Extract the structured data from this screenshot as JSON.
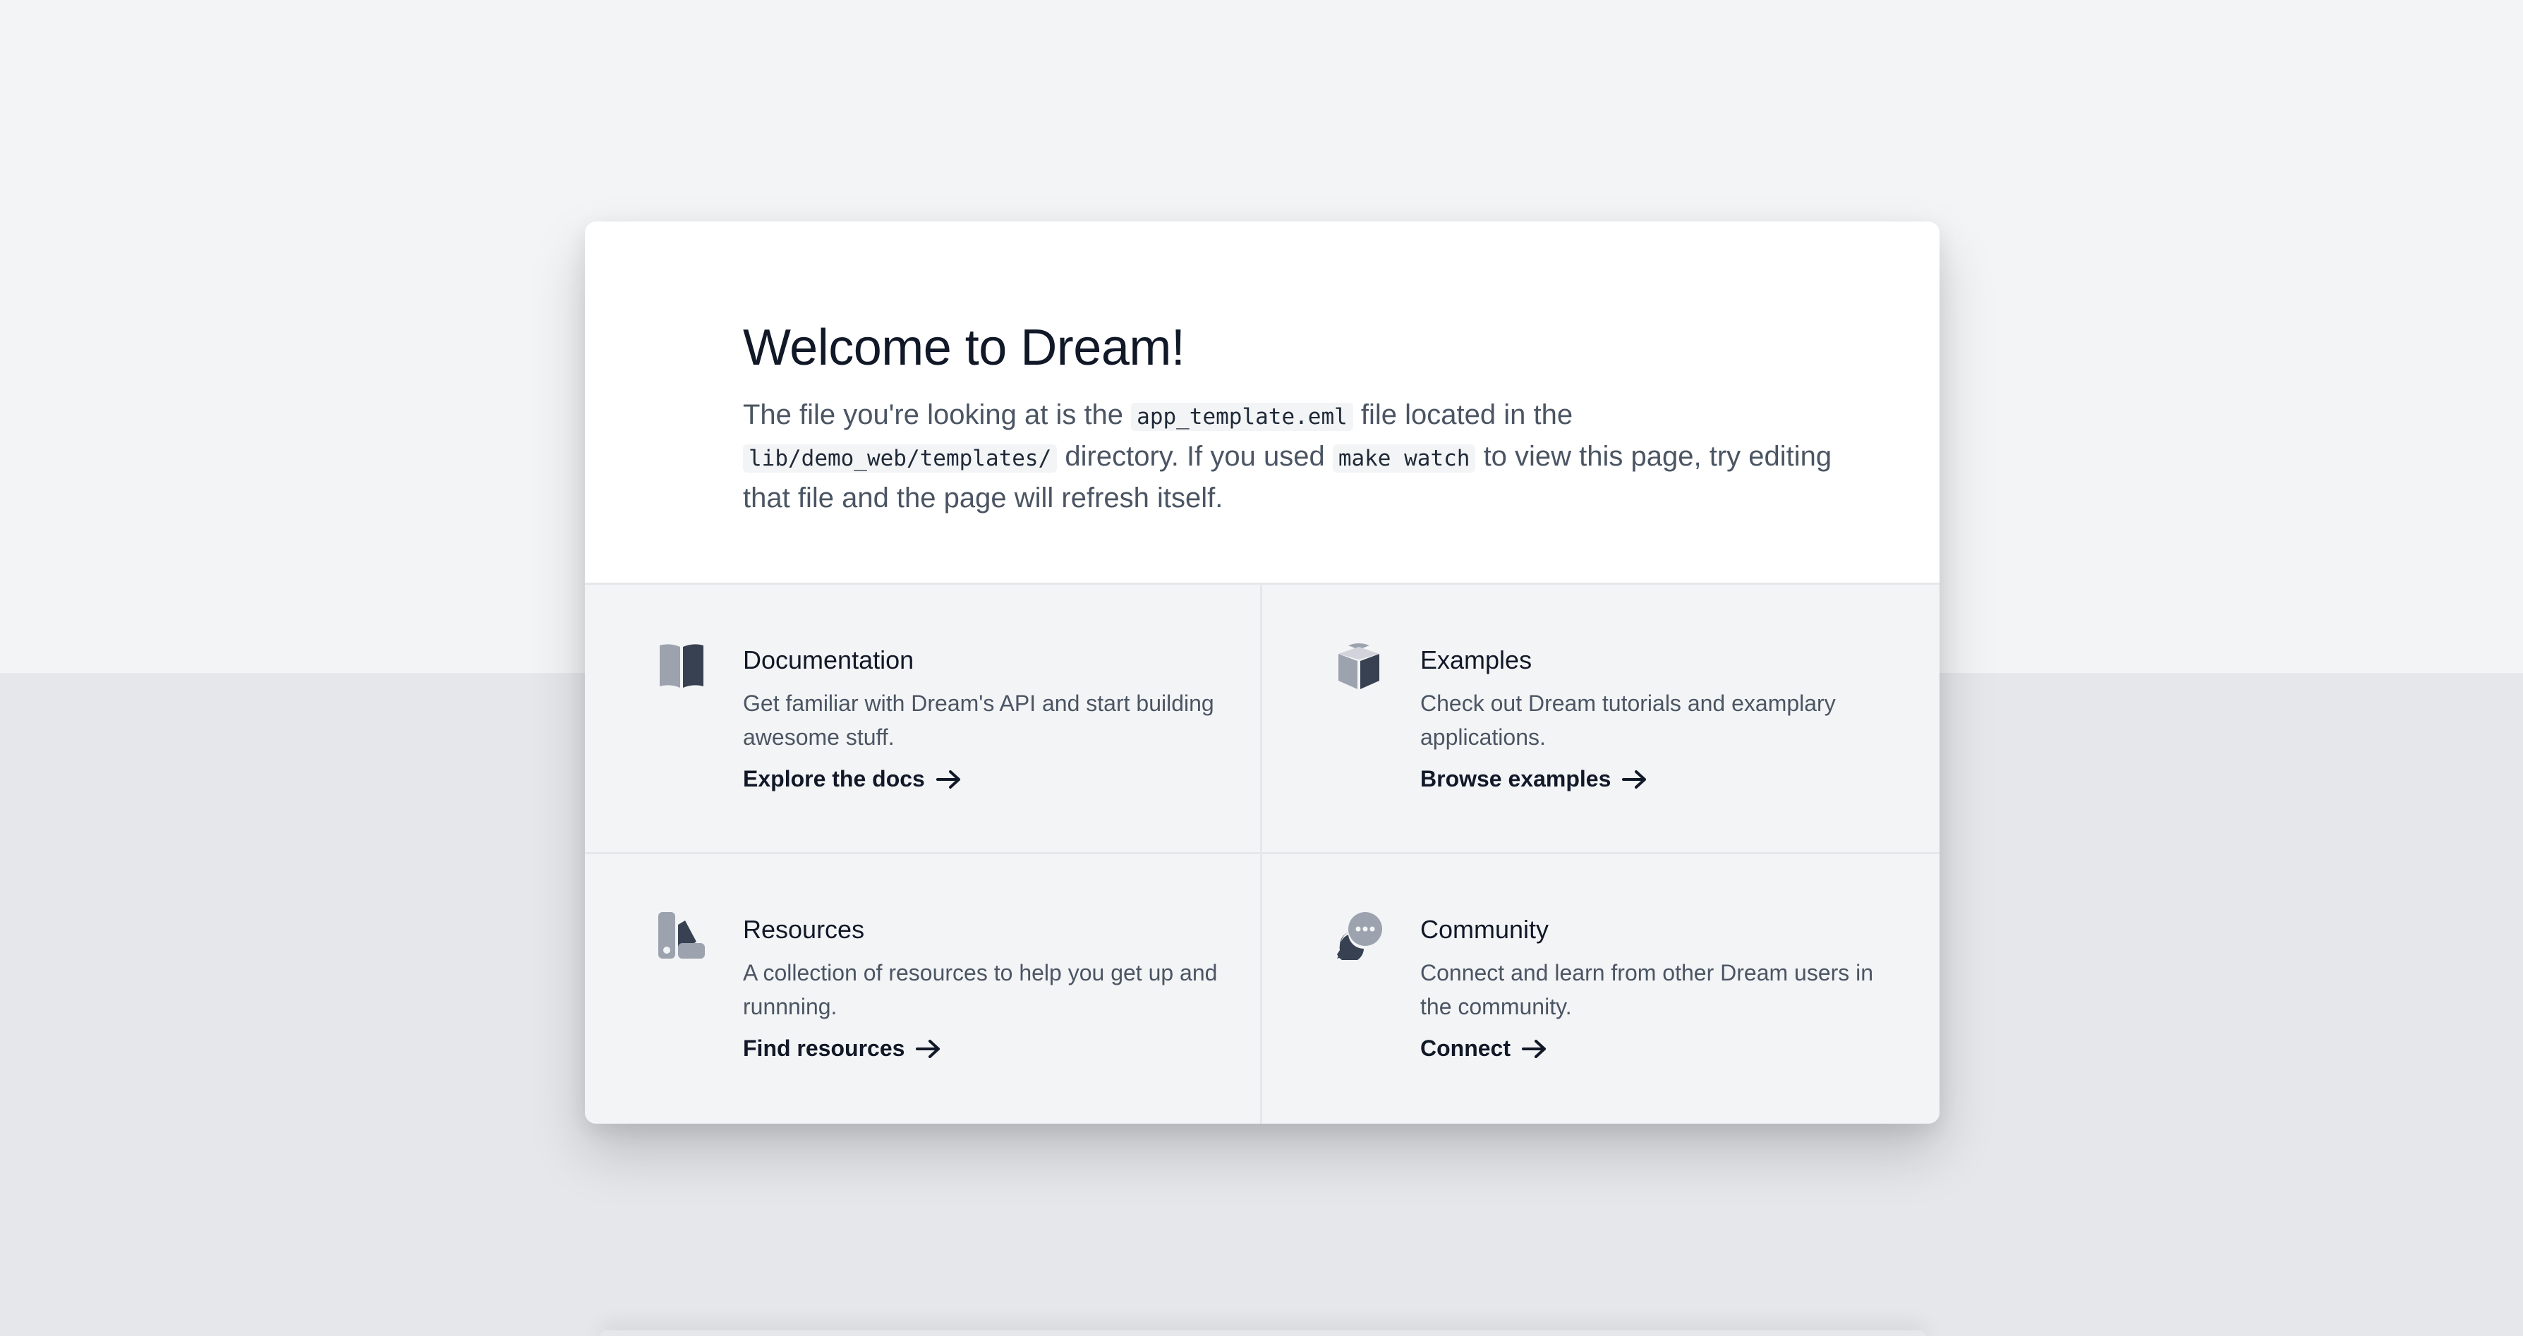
{
  "hero": {
    "title": "Welcome to Dream!",
    "intro_1": "The file you're looking at is the ",
    "code_template": "app_template.eml",
    "intro_2": " file located in the ",
    "code_dir": "lib/demo_web/templates/",
    "intro_3": " directory. If you used ",
    "code_cmd": "make watch",
    "intro_4": " to view this page, try editing that file and the page will refresh itself."
  },
  "cards": [
    {
      "title": "Documentation",
      "description": "Get familiar with Dream's API and start building awesome stuff.",
      "link": "Explore the docs",
      "icon": "book-icon"
    },
    {
      "title": "Examples",
      "description": "Check out Dream tutorials and examplary applications.",
      "link": "Browse examples",
      "icon": "cube-icon"
    },
    {
      "title": "Resources",
      "description": "A collection of resources to help you get up and runnning.",
      "link": "Find resources",
      "icon": "swatch-icon"
    },
    {
      "title": "Community",
      "description": "Connect and learn from other Dream users in the community.",
      "link": "Connect",
      "icon": "chat-bubbles-icon"
    }
  ],
  "colors": {
    "icon_light": "#9ca3af",
    "icon_dark": "#374151",
    "background_top": "#f3f4f6",
    "background_bottom": "#e5e7eb"
  }
}
